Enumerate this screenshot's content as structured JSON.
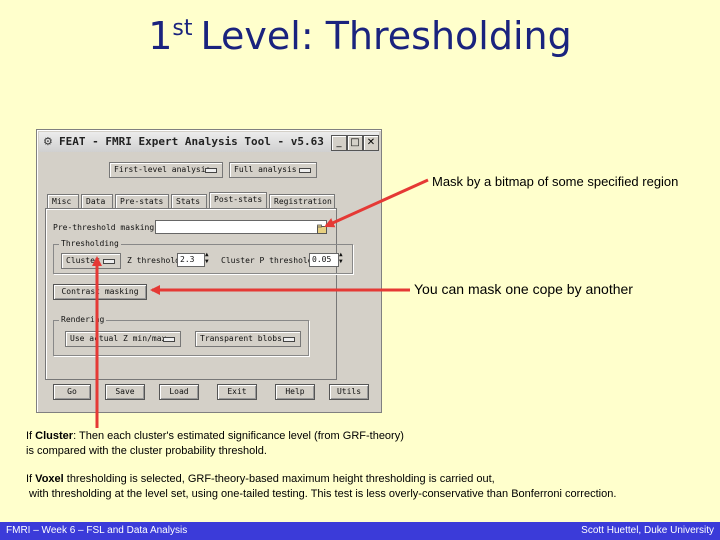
{
  "slide": {
    "title_prefix": "1",
    "title_sup": "st",
    "title_main": "Level: Thresholding"
  },
  "window": {
    "title": "FEAT - FMRI Expert Analysis Tool - v5.63",
    "icon": "feat-app-icon",
    "analysis_level": "First-level analysis",
    "analysis_type": "Full analysis",
    "tabs": [
      {
        "label": "Misc"
      },
      {
        "label": "Data"
      },
      {
        "label": "Pre-stats"
      },
      {
        "label": "Stats"
      },
      {
        "label": "Post-stats"
      },
      {
        "label": "Registration"
      }
    ],
    "prethreshold_label": "Pre-threshold masking",
    "prethreshold_value": "",
    "thresholding_group": "Thresholding",
    "threshold_type": "Cluster",
    "z_threshold_label": "Z threshold",
    "z_threshold_value": "2.3",
    "cluster_p_label": "Cluster P threshold",
    "cluster_p_value": "0.05",
    "contrast_masking_label": "Contrast masking",
    "rendering_group": "Rendering",
    "render_type": "Use actual Z min/max",
    "transparency": "Transparent blobs",
    "buttons": {
      "go": "Go",
      "save": "Save",
      "load": "Load",
      "exit": "Exit",
      "help": "Help",
      "utils": "Utils"
    }
  },
  "annotations": {
    "mask_bitmap": "Mask by a bitmap of some specified region",
    "mask_cope": "You can mask one cope by another",
    "cluster_bold": "Cluster",
    "cluster_prefix": "If ",
    "cluster_rest": ": Then each cluster's estimated significance level (from GRF-theory)",
    "cluster_line2": "is compared with the cluster probability threshold.",
    "voxel_prefix": "If ",
    "voxel_bold": "Voxel",
    "voxel_rest": " thresholding is selected, GRF-theory-based maximum height thresholding is carried out,",
    "voxel_line2": "with thresholding at the level set, using one-tailed testing. This test is less overly-conservative than Bonferroni correction."
  },
  "footer": {
    "left": "FMRI – Week 6 – FSL and Data Analysis",
    "right": "Scott Huettel, Duke University"
  },
  "colors": {
    "background": "#ffffcc",
    "title": "#1a237e",
    "arrow": "#e53935",
    "footer": "#3b3bd9"
  }
}
